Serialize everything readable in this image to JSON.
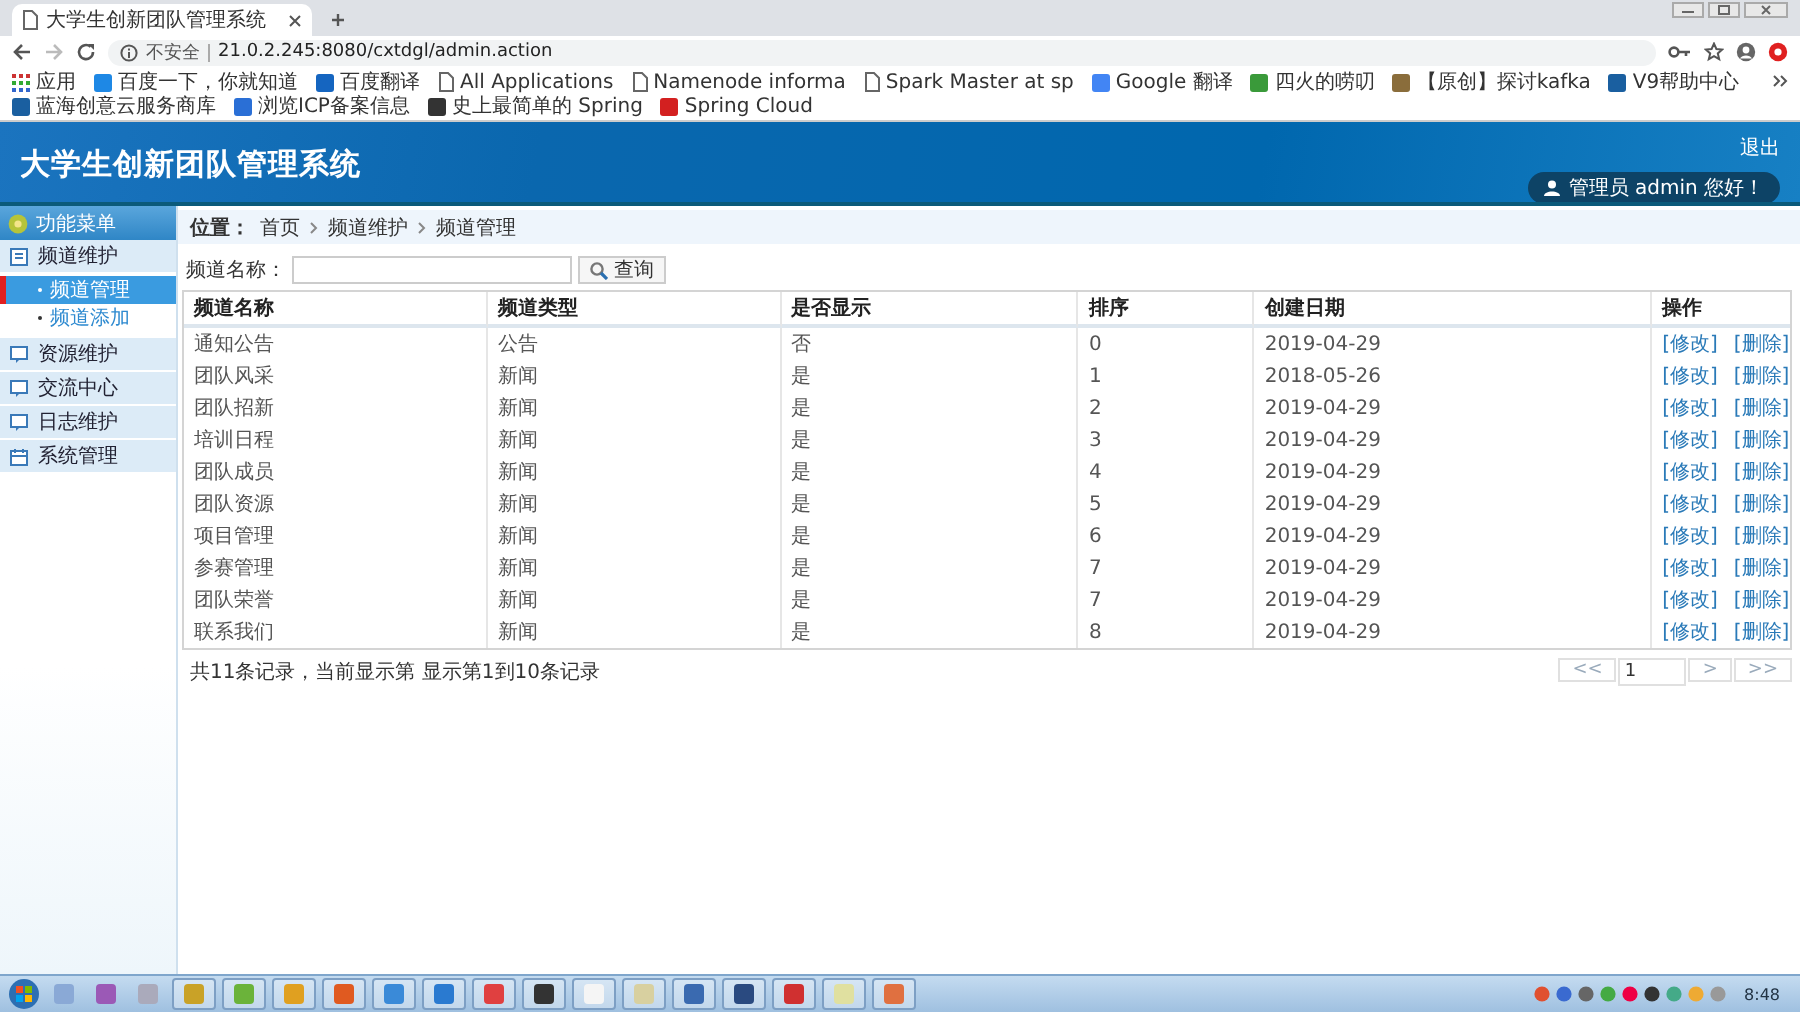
{
  "browser": {
    "tab_title": "大学生创新团队管理系统",
    "security": "不安全",
    "url": "21.0.2.245:8080/cxtdgl/admin.action",
    "bookmarks": [
      {
        "label": "应用"
      },
      {
        "label": "百度一下，你就知道"
      },
      {
        "label": "百度翻译"
      },
      {
        "label": "All Applications"
      },
      {
        "label": "Namenode informa"
      },
      {
        "label": "Spark Master at sp"
      },
      {
        "label": "Google 翻译"
      },
      {
        "label": "四火的唠叨"
      },
      {
        "label": "【原创】探讨kafka"
      },
      {
        "label": "V9帮助中心"
      },
      {
        "label": "蓝海创意云服务商库"
      },
      {
        "label": "浏览ICP备案信息"
      },
      {
        "label": "史上最简单的 Spring"
      },
      {
        "label": "Spring Cloud"
      }
    ]
  },
  "header": {
    "title": "大学生创新团队管理系统",
    "logout": "退出",
    "user": "管理员 admin 您好！"
  },
  "sidebar": {
    "title": "功能菜单",
    "items": [
      {
        "label": "频道维护",
        "children": [
          {
            "label": "频道管理",
            "selected": true
          },
          {
            "label": "频道添加",
            "selected": false
          }
        ]
      },
      {
        "label": "资源维护"
      },
      {
        "label": "交流中心"
      },
      {
        "label": "日志维护"
      },
      {
        "label": "系统管理"
      }
    ]
  },
  "breadcrumb": {
    "label": "位置：",
    "items": [
      "首页",
      "频道维护",
      "频道管理"
    ]
  },
  "search": {
    "label": "频道名称：",
    "button": "查询"
  },
  "table": {
    "columns": [
      "频道名称",
      "频道类型",
      "是否显示",
      "排序",
      "创建日期",
      "操作"
    ],
    "rows": [
      {
        "cells": [
          "通知公告",
          "公告",
          "否",
          "0",
          "2019-04-29"
        ],
        "actions": [
          "[修改]",
          "[删除]"
        ]
      },
      {
        "cells": [
          "团队风采",
          "新闻",
          "是",
          "1",
          "2018-05-26"
        ],
        "actions": [
          "[修改]",
          "[删除]"
        ]
      },
      {
        "cells": [
          "团队招新",
          "新闻",
          "是",
          "2",
          "2019-04-29"
        ],
        "actions": [
          "[修改]",
          "[删除]"
        ]
      },
      {
        "cells": [
          "培训日程",
          "新闻",
          "是",
          "3",
          "2019-04-29"
        ],
        "actions": [
          "[修改]",
          "[删除]"
        ]
      },
      {
        "cells": [
          "团队成员",
          "新闻",
          "是",
          "4",
          "2019-04-29"
        ],
        "actions": [
          "[修改]",
          "[删除]"
        ]
      },
      {
        "cells": [
          "团队资源",
          "新闻",
          "是",
          "5",
          "2019-04-29"
        ],
        "actions": [
          "[修改]",
          "[删除]"
        ]
      },
      {
        "cells": [
          "项目管理",
          "新闻",
          "是",
          "6",
          "2019-04-29"
        ],
        "actions": [
          "[修改]",
          "[删除]"
        ]
      },
      {
        "cells": [
          "参赛管理",
          "新闻",
          "是",
          "7",
          "2019-04-29"
        ],
        "actions": [
          "[修改]",
          "[删除]"
        ]
      },
      {
        "cells": [
          "团队荣誉",
          "新闻",
          "是",
          "7",
          "2019-04-29"
        ],
        "actions": [
          "[修改]",
          "[删除]"
        ]
      },
      {
        "cells": [
          "联系我们",
          "新闻",
          "是",
          "8",
          "2019-04-29"
        ],
        "actions": [
          "[修改]",
          "[删除]"
        ]
      }
    ]
  },
  "footer": {
    "summary": "共11条记录，当前显示第 显示第1到10条记录",
    "pager": [
      {
        "label": "<<",
        "kind": "button"
      },
      {
        "label": "1",
        "kind": "page"
      },
      {
        "label": ">",
        "kind": "button"
      },
      {
        "label": ">>",
        "kind": "button"
      }
    ]
  },
  "taskbar": {
    "clock": "8:48"
  }
}
